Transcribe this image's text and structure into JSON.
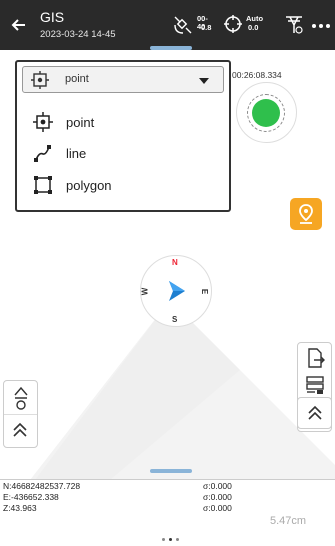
{
  "header": {
    "back_icon": "arrow-left-icon",
    "title": "GIS",
    "datetime": "2023-03-24 14-45",
    "satellite": {
      "top": "00-40",
      "bottom": "0.8"
    },
    "position_mode": {
      "top": "Auto",
      "bottom": "0.0"
    },
    "antenna_icon": "antenna-icon",
    "more_icon": "more-icon"
  },
  "geometry_select": {
    "selected": "point",
    "options": [
      {
        "label": "point",
        "icon": "point-icon"
      },
      {
        "label": "line",
        "icon": "line-icon"
      },
      {
        "label": "polygon",
        "icon": "polygon-icon"
      }
    ]
  },
  "timer": "00:26:08.334",
  "compass": {
    "n": "N",
    "s": "S",
    "e": "E",
    "w": "W"
  },
  "coordinates": {
    "n": "N:46682482537.728",
    "e": "E:-436652.338",
    "z": "Z:43.963",
    "sn": "σ:0.000",
    "se": "σ:0.000",
    "sz": "σ:0.000"
  },
  "scale": "5.47cm",
  "colors": {
    "accent": "#f6a623",
    "status_green": "#2fbf4c",
    "navy_arrow": "#1e7fd0",
    "topbar": "#2a2a2a"
  }
}
